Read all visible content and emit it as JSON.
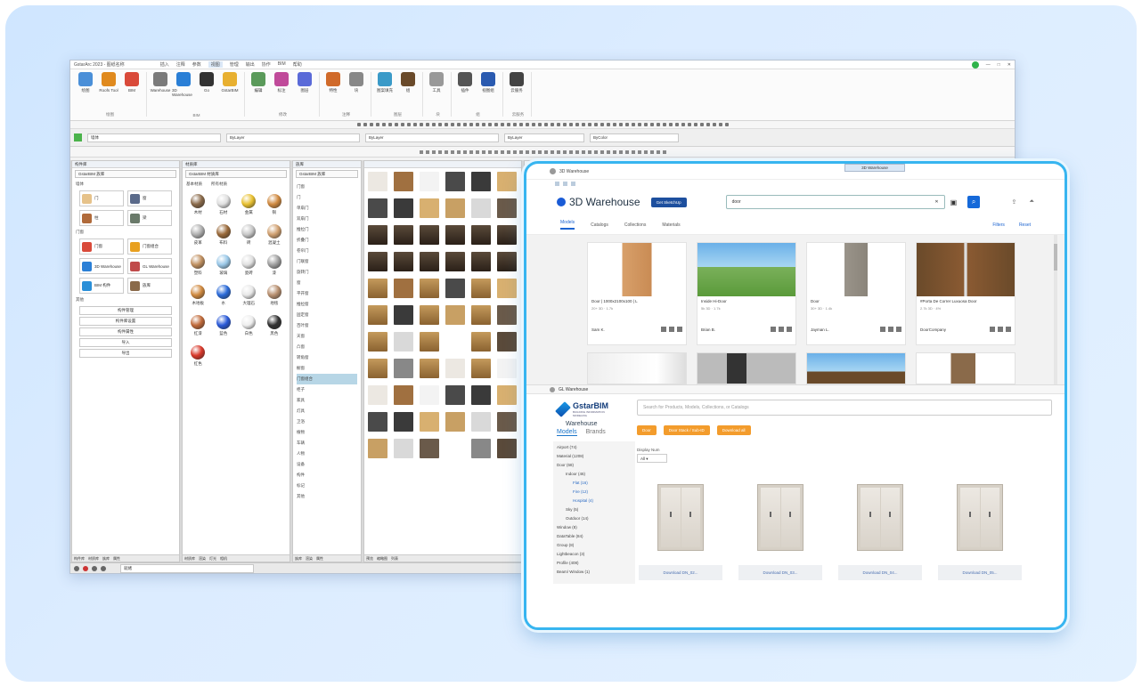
{
  "cad": {
    "title": "GstarArc 2023 - 图纸名称",
    "menu_tabs": [
      "插入",
      "注释",
      "参数",
      "视图",
      "管理",
      "输出",
      "协作",
      "BIM",
      "帮助"
    ],
    "ribbon_buttons": [
      "绘图",
      "Roofs Tool",
      "BIM",
      "Warehouse",
      "3D Warehouse",
      "Go",
      "GstarBIM",
      "编辑",
      "标注",
      "图层",
      "特性",
      "块",
      "图案填充",
      "组",
      "工具",
      "插件",
      "视图组",
      "云服务"
    ],
    "ribbon_groups": [
      "绘图",
      "BIM",
      "修改",
      "注释",
      "图层",
      "块",
      "组",
      "云服务"
    ],
    "toolbar_select1": "墙体",
    "toolbar_select2": "ByLayer",
    "toolbar_select3": "ByLayer",
    "toolbar_select4": "ByLayer",
    "toolbar_select5": "ByColor",
    "left_panel": {
      "title": "构件库",
      "field": "GstarBIM 族库",
      "sec1": "墙体",
      "tiles": [
        "门",
        "窗",
        "柱",
        "梁"
      ],
      "sec2": "门窗",
      "tiles2": [
        "门窗",
        "门窗组合",
        "3D Warehouse",
        "GL Warehouse",
        "BIM 构件",
        "族库"
      ],
      "sec3": "其他",
      "buttons": [
        "构件管理",
        "构件库设置",
        "构件属性",
        "导入",
        "导出"
      ],
      "tabs": [
        "构件库",
        "材质库",
        "族库",
        "属性"
      ]
    },
    "mat_panel": {
      "title": "材质库",
      "field": "GstarBIM 材质库",
      "tabs_label": "基本材质",
      "tabs_label2": "所有材质",
      "materials": [
        "木材",
        "石材",
        "金属",
        "铜",
        "皮革",
        "布料",
        "砖",
        "混凝土",
        "塑料",
        "玻璃",
        "瓷砖",
        "漆",
        "木地板",
        "水",
        "大理石",
        "地毯",
        "红漆",
        "蓝色",
        "白色",
        "黑色",
        "红色"
      ],
      "footer_tabs": [
        "材质库",
        "渲染",
        "灯光",
        "相机"
      ]
    },
    "tree_panel": {
      "title": "族库",
      "field": "GstarBIM 族库",
      "items": [
        "门窗",
        "门",
        "单扇门",
        "双扇门",
        "推拉门",
        "折叠门",
        "卷帘门",
        "门联窗",
        "旋转门",
        "窗",
        "平开窗",
        "推拉窗",
        "固定窗",
        "百叶窗",
        "天窗",
        "凸窗",
        "转角窗",
        "橱窗",
        "门窗组合",
        "柜子",
        "家具",
        "灯具",
        "卫浴",
        "植物",
        "车辆",
        "人物",
        "设备",
        "构件",
        "标记",
        "其他"
      ],
      "highlight": "门窗组合",
      "footer_tabs": [
        "族库",
        "渲染",
        "属性"
      ]
    },
    "grid_panel": {
      "footer_tabs": [
        "预览",
        "缩略图",
        "列表"
      ]
    },
    "status": "就绪"
  },
  "wh3d": {
    "strip": "3D Warehouse",
    "tab_title": "3D Warehouse",
    "logo": "3D Warehouse",
    "get_button": "Get SketchUp",
    "search_value": "door",
    "tabs": [
      "Models",
      "Catalogs",
      "Collections",
      "Materials"
    ],
    "right_links": [
      "Filters",
      "Reset"
    ],
    "cards": [
      {
        "name": "Door | 1000x2100x100 | L",
        "meta": "20+ 3D  ·  1.7k",
        "author": "Sam K."
      },
      {
        "name": "Inside Hi-Door",
        "meta": "5k 3D  ·  1.7k",
        "author": "Brian B."
      },
      {
        "name": "Door",
        "meta": "30+ 3D  ·  1.4k",
        "author": "Jayman L."
      },
      {
        "name": "#Porta De Correr Luxuosa Door",
        "meta": "2.7k 3D  ·  4%",
        "author": "DoorCompany"
      }
    ]
  },
  "gstar": {
    "bar_title": "GL Warehouse",
    "logo_name": "GstarBIM",
    "logo_sub": "BUILDING INFORMATION MODELING",
    "warehouse": "Warehouse",
    "tab_models": "Models",
    "tab_brands": "Brands",
    "categories": [
      {
        "label": "Airport (74)",
        "cls": ""
      },
      {
        "label": "Material (1208)",
        "cls": ""
      },
      {
        "label": "Door (68)",
        "cls": ""
      },
      {
        "label": "Indoor (46)",
        "cls": "sub2"
      },
      {
        "label": "Flat (16)",
        "cls": "sub"
      },
      {
        "label": "Fire (12)",
        "cls": "sub"
      },
      {
        "label": "Hospital (4)",
        "cls": "sub"
      },
      {
        "label": "Sky (5)",
        "cls": "sub2"
      },
      {
        "label": "Outdoor (14)",
        "cls": "sub2"
      },
      {
        "label": "Window (8)",
        "cls": ""
      },
      {
        "label": "DataTable (84)",
        "cls": ""
      },
      {
        "label": "Group (8)",
        "cls": ""
      },
      {
        "label": "Lightbeacon (3)",
        "cls": ""
      },
      {
        "label": "Profile (408)",
        "cls": ""
      },
      {
        "label": "Beam/ Window (1)",
        "cls": ""
      }
    ],
    "search_placeholder": "Search for Products, Models, Collections, or Catalogs",
    "filters": [
      "Door",
      "Door Stack / Sub-ID",
      "Download all"
    ],
    "display_label": "Display Num",
    "display_value": "All",
    "downloads": [
      "Download DN_02...",
      "Download DN_03...",
      "Download DN_04...",
      "Download DN_05..."
    ]
  }
}
